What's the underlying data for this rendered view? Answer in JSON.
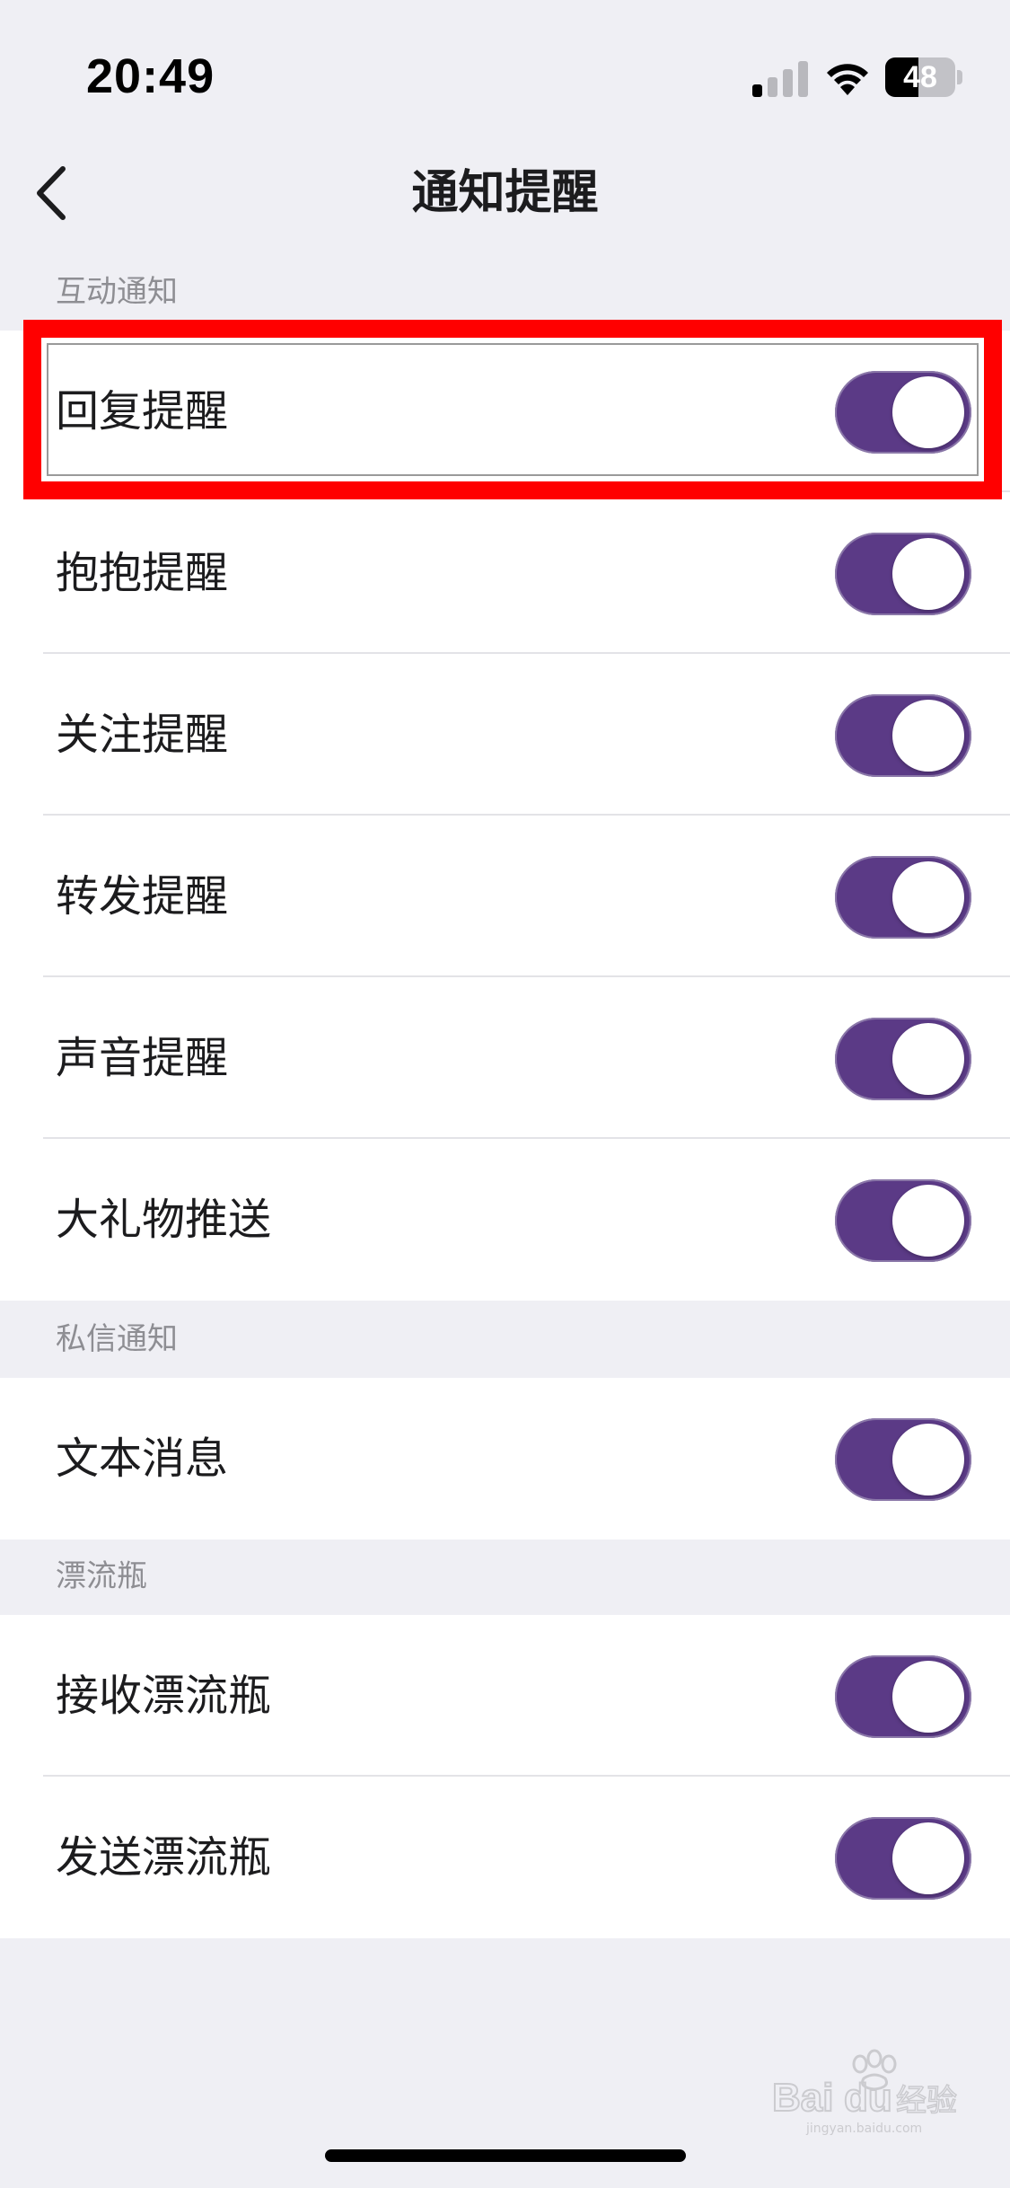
{
  "status_bar": {
    "time": "20:49",
    "signal_bars_active": 1,
    "signal_bars_total": 4,
    "battery_level": "48",
    "battery_fraction": 0.48
  },
  "nav": {
    "title": "通知提醒",
    "back_icon": "chevron-left-icon"
  },
  "sections": [
    {
      "header": "互动通知",
      "items": [
        {
          "label": "回复提醒",
          "on": true
        },
        {
          "label": "抱抱提醒",
          "on": true
        },
        {
          "label": "关注提醒",
          "on": true
        },
        {
          "label": "转发提醒",
          "on": true
        },
        {
          "label": "声音提醒",
          "on": true
        },
        {
          "label": "大礼物推送",
          "on": true
        }
      ]
    },
    {
      "header": "私信通知",
      "items": [
        {
          "label": "文本消息",
          "on": true
        }
      ]
    },
    {
      "header": "漂流瓶",
      "items": [
        {
          "label": "接收漂流瓶",
          "on": true
        },
        {
          "label": "发送漂流瓶",
          "on": true
        }
      ]
    }
  ],
  "colors": {
    "toggle_on": "#5b3a86",
    "highlight": "#ff0000",
    "background": "#efeff4"
  },
  "watermark": {
    "logo_text": "Baidu经验",
    "url": "jingyan.baidu.com"
  }
}
